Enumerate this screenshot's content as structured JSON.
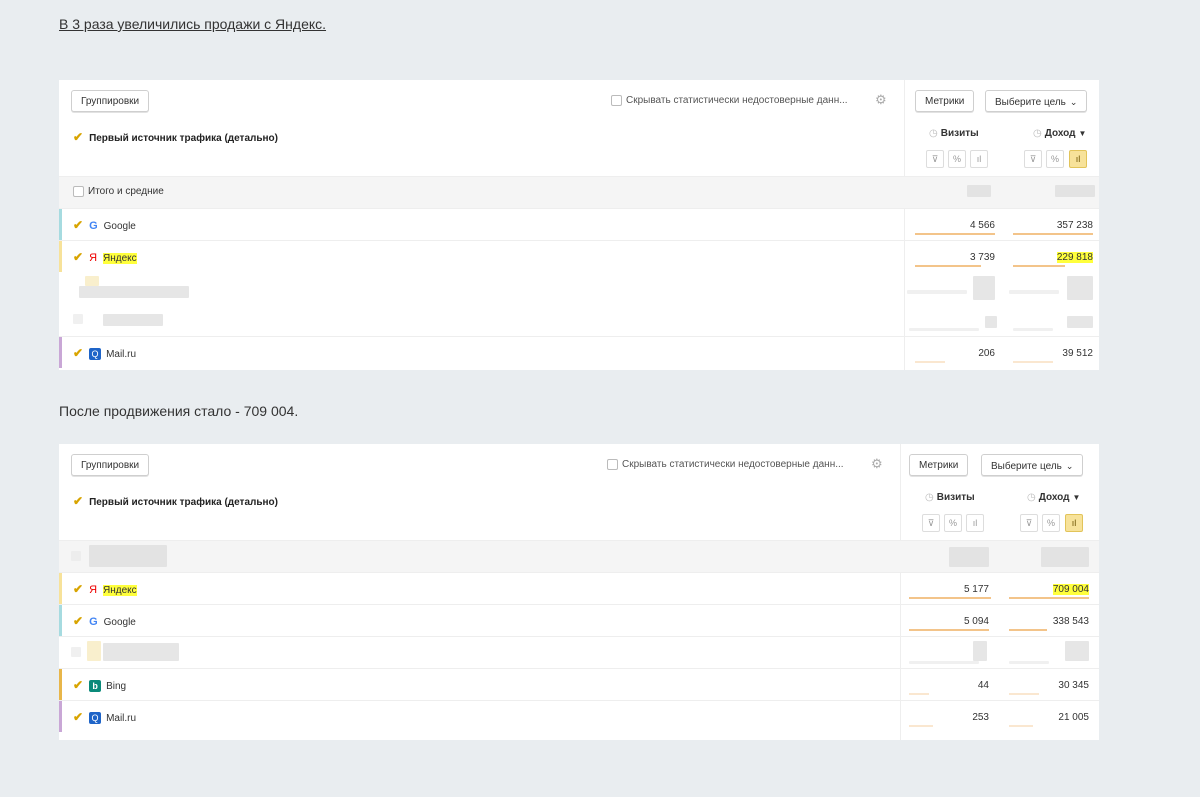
{
  "heading": "В 3 раза увеличились  продажи с Яндекс.",
  "between_text": "После продвижения стало -  709 004.",
  "common": {
    "groupings_label": "Группировки",
    "hide_stat_label": "Скрывать статистически недостоверные данн...",
    "metrics_label": "Метрики",
    "goal_label": "Выберите цель",
    "dimension_title": "Первый источник трафика (детально)",
    "visits_label": "Визиты",
    "income_label": "Доход",
    "totals_label": "Итого и средние",
    "icons": [
      "checkbox-icon",
      "gear-icon",
      "chevron-down-icon",
      "clock-icon",
      "sort-desc-icon",
      "filter-icon",
      "percent-icon",
      "bar-chart-icon",
      "google-icon",
      "yandex-icon",
      "mail-ru-icon",
      "bing-icon"
    ]
  },
  "before": {
    "rows": [
      {
        "source": "Google",
        "visits": "4 566",
        "income": "357 238"
      },
      {
        "source": "Яндекс",
        "visits": "3 739",
        "income": "229 818"
      },
      {
        "source": "Mail.ru",
        "visits": "206",
        "income": "39 512"
      }
    ]
  },
  "after": {
    "rows": [
      {
        "source": "Яндекс",
        "visits": "5 177",
        "income": "709 004"
      },
      {
        "source": "Google",
        "visits": "5 094",
        "income": "338 543"
      },
      {
        "source": "Bing",
        "visits": "44",
        "income": "30 345"
      },
      {
        "source": "Mail.ru",
        "visits": "253",
        "income": "21 005"
      }
    ]
  },
  "colors": {
    "highlight": "#ffff3c",
    "check": "#d8a400",
    "bar": "#f3c48a",
    "background": "#e9edf0"
  }
}
